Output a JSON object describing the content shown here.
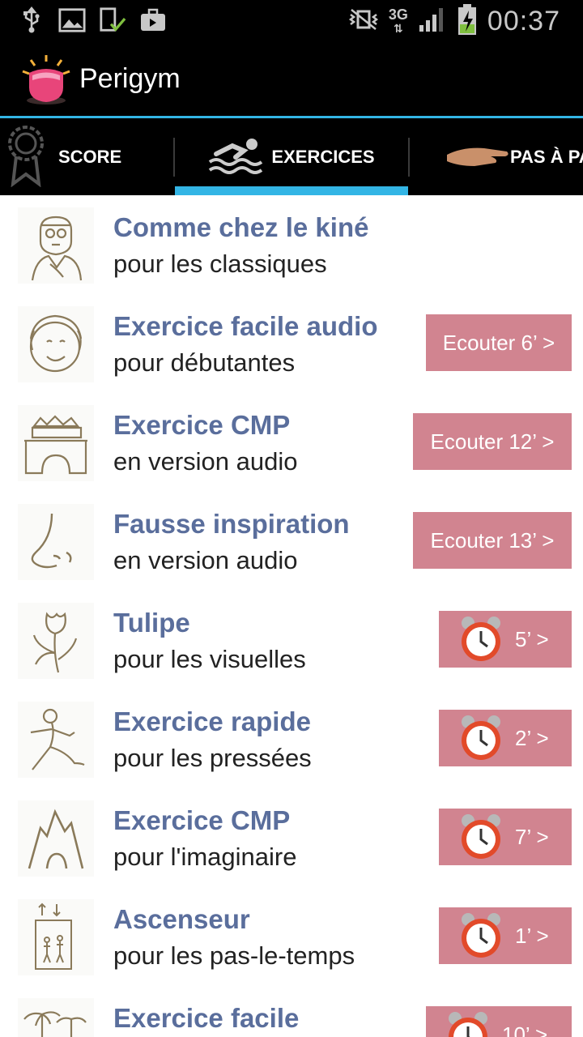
{
  "status_bar": {
    "network": "3G",
    "time": "00:37"
  },
  "app": {
    "title": "Perigym"
  },
  "tabs": [
    {
      "label": "SCORE",
      "icon": "ribbon-icon"
    },
    {
      "label": "EXERCICES",
      "icon": "swimmer-icon",
      "selected": true
    },
    {
      "label": "PAS À PA",
      "icon": "hand-icon"
    }
  ],
  "exercises": [
    {
      "title": "Comme chez le kiné",
      "subtitle": "pour les classiques",
      "icon": "physio-face-icon",
      "button": null
    },
    {
      "title": "Exercice facile audio",
      "subtitle": "pour débutantes",
      "icon": "smiling-face-icon",
      "button": {
        "type": "audio",
        "label": "Ecouter 6’ >"
      }
    },
    {
      "title": "Exercice CMP",
      "subtitle": "en version audio",
      "icon": "bridge-icon",
      "button": {
        "type": "audio",
        "label": "Ecouter 12’ >"
      }
    },
    {
      "title": "Fausse inspiration",
      "subtitle": "en version audio",
      "icon": "nose-icon",
      "button": {
        "type": "audio",
        "label": "Ecouter 13’ >"
      }
    },
    {
      "title": "Tulipe",
      "subtitle": "pour les visuelles",
      "icon": "tulip-icon",
      "button": {
        "type": "timer",
        "label": "5’ >"
      }
    },
    {
      "title": "Exercice rapide",
      "subtitle": "pour les pressées",
      "icon": "runner-icon",
      "button": {
        "type": "timer",
        "label": "2’ >"
      }
    },
    {
      "title": "Exercice CMP",
      "subtitle": "pour l'imaginaire",
      "icon": "mountain-icon",
      "button": {
        "type": "timer",
        "label": "7’ >"
      }
    },
    {
      "title": "Ascenseur",
      "subtitle": "pour les pas-le-temps",
      "icon": "elevator-icon",
      "button": {
        "type": "timer",
        "label": "1’ >"
      }
    },
    {
      "title": "Exercice facile",
      "subtitle": "",
      "icon": "palm-trees-icon",
      "button": {
        "type": "timer",
        "label": "10’ >"
      }
    }
  ],
  "colors": {
    "accent": "#33b5e5",
    "title_text": "#5a6e9c",
    "button_bg": "#d18490"
  }
}
